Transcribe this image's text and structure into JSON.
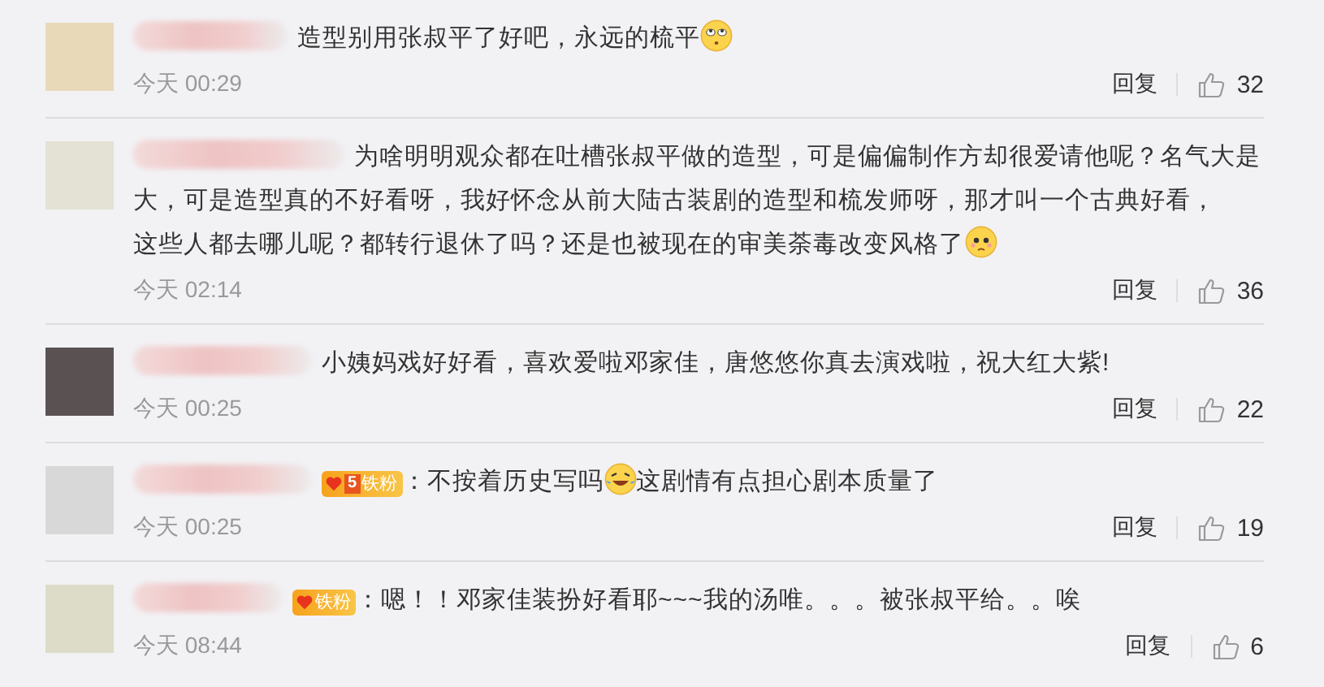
{
  "comments": [
    {
      "parts": [
        {
          "kind": "text",
          "text": "造型别用张叔平了好吧，永远的梳平"
        },
        {
          "kind": "rolleyes"
        }
      ],
      "time": "今天 00:29",
      "reply": "回复",
      "likes": "32"
    },
    {
      "parts": [
        {
          "kind": "text",
          "text": "为啥明明观众都在吐槽张叔平做的造型，可是偏偏制作方却很爱请他呢？名气大是"
        },
        {
          "kind": "linebreak"
        },
        {
          "kind": "text",
          "text": "大，可是造型真的不好看呀，我好怀念从前大陆古装剧的造型和梳发师呀，那才叫一个古典好看，"
        },
        {
          "kind": "linebreak"
        },
        {
          "kind": "text",
          "text": "这些人都去哪儿呢？都转行退休了吗？还是也被现在的审美荼毒改变风格了"
        },
        {
          "kind": "sad"
        }
      ],
      "time": "今天 02:14",
      "reply": "回复",
      "likes": "36"
    },
    {
      "parts": [
        {
          "kind": "text",
          "text": "小姨妈戏好好看，喜欢爱啦邓家佳，唐悠悠你真去演戏啦，祝大红大紫!"
        }
      ],
      "time": "今天 00:25",
      "reply": "回复",
      "likes": "22"
    },
    {
      "badge": {
        "level": "5",
        "label": "铁粉"
      },
      "parts": [
        {
          "kind": "text",
          "text": "：不按着历史写吗"
        },
        {
          "kind": "laughcry"
        },
        {
          "kind": "text",
          "text": "这剧情有点担心剧本质量了"
        }
      ],
      "time": "今天 00:25",
      "reply": "回复",
      "likes": "19"
    },
    {
      "badge": {
        "label": "铁粉"
      },
      "parts": [
        {
          "kind": "text",
          "text": "：嗯！！邓家佳装扮好看耶~~~我的汤唯。。。被张叔平给。。唉"
        }
      ],
      "time": "今天 08:44",
      "reply": "回复",
      "likes": "6"
    }
  ]
}
